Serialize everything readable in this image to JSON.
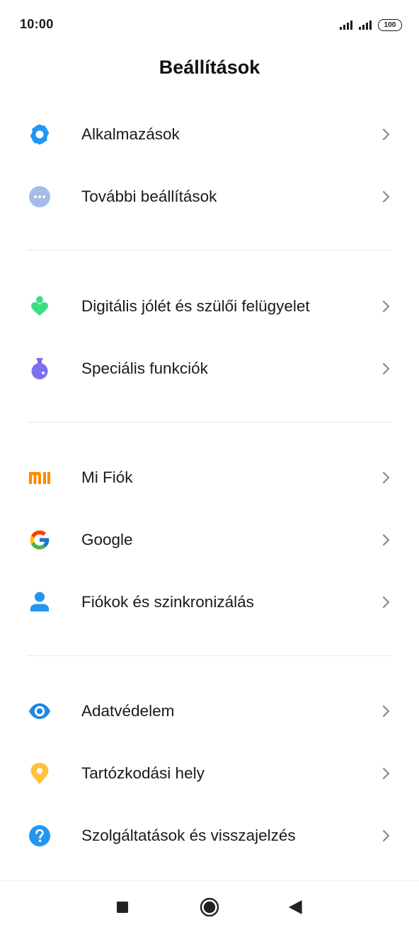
{
  "status_bar": {
    "time": "10:00",
    "battery": "100"
  },
  "header": {
    "title": "Beállítások"
  },
  "groups": [
    {
      "items": [
        {
          "label": "Alkalmazások",
          "icon": "gear-icon",
          "color": "#2196F3"
        },
        {
          "label": "További beállítások",
          "icon": "more-dots-icon",
          "color": "#A4BCEA"
        }
      ]
    },
    {
      "items": [
        {
          "label": "Digitális jólét és szülői felügyelet",
          "icon": "wellbeing-icon",
          "color": "#3DDC84"
        },
        {
          "label": "Speciális funkciók",
          "icon": "flask-icon",
          "color": "#7C6FF0"
        }
      ]
    },
    {
      "items": [
        {
          "label": "Mi Fiók",
          "icon": "mi-logo-icon",
          "color": "#FF8A00"
        },
        {
          "label": "Google",
          "icon": "google-icon",
          "color": "#4285F4"
        },
        {
          "label": "Fiókok és szinkronizálás",
          "icon": "person-icon",
          "color": "#2196F3"
        }
      ]
    },
    {
      "items": [
        {
          "label": "Adatvédelem",
          "icon": "eye-icon",
          "color": "#1E88E5"
        },
        {
          "label": "Tartózkodási hely",
          "icon": "location-pin-icon",
          "color": "#FFC23D"
        },
        {
          "label": "Szolgáltatások és visszajelzés",
          "icon": "help-icon",
          "color": "#2196F3"
        }
      ]
    }
  ],
  "nav_bar": {
    "recents": "square-icon",
    "home": "home-circle-icon",
    "back": "back-triangle-icon"
  }
}
